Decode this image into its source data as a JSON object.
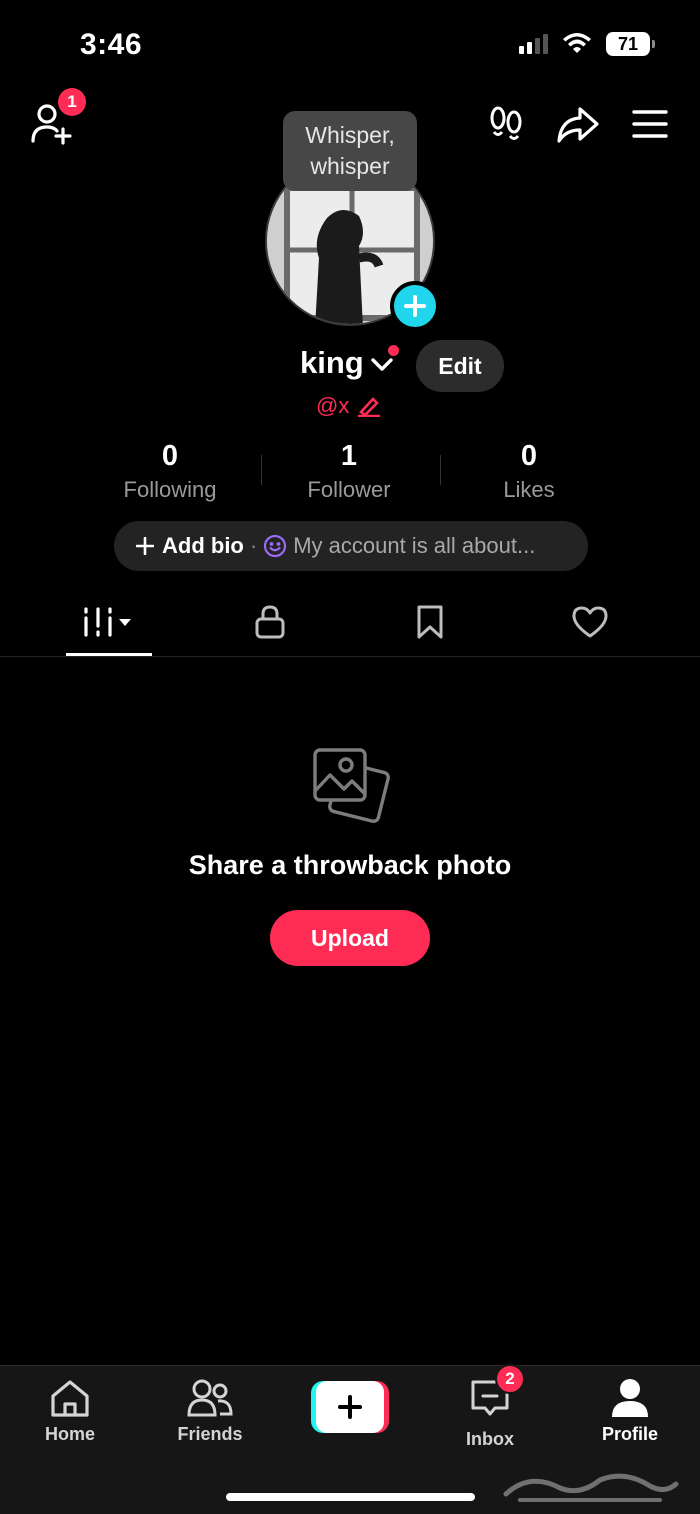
{
  "status_bar": {
    "time": "3:46",
    "battery": "71"
  },
  "top_bar": {
    "add_friends_badge": "1"
  },
  "tooltip": {
    "text": "Whisper, whisper"
  },
  "profile": {
    "name": "king",
    "handle": "@x",
    "edit_label": "Edit"
  },
  "stats": [
    {
      "value": "0",
      "label": "Following"
    },
    {
      "value": "1",
      "label": "Follower"
    },
    {
      "value": "0",
      "label": "Likes"
    }
  ],
  "bio": {
    "add_label": "Add bio",
    "separator": "·",
    "placeholder": "My account is all about..."
  },
  "empty_state": {
    "title": "Share a throwback photo",
    "button": "Upload"
  },
  "bottom_nav": {
    "home": "Home",
    "friends": "Friends",
    "inbox": "Inbox",
    "inbox_badge": "2",
    "profile": "Profile"
  },
  "colors": {
    "accent": "#fe2c55",
    "cyan": "#20d5ec",
    "background": "#000000"
  }
}
